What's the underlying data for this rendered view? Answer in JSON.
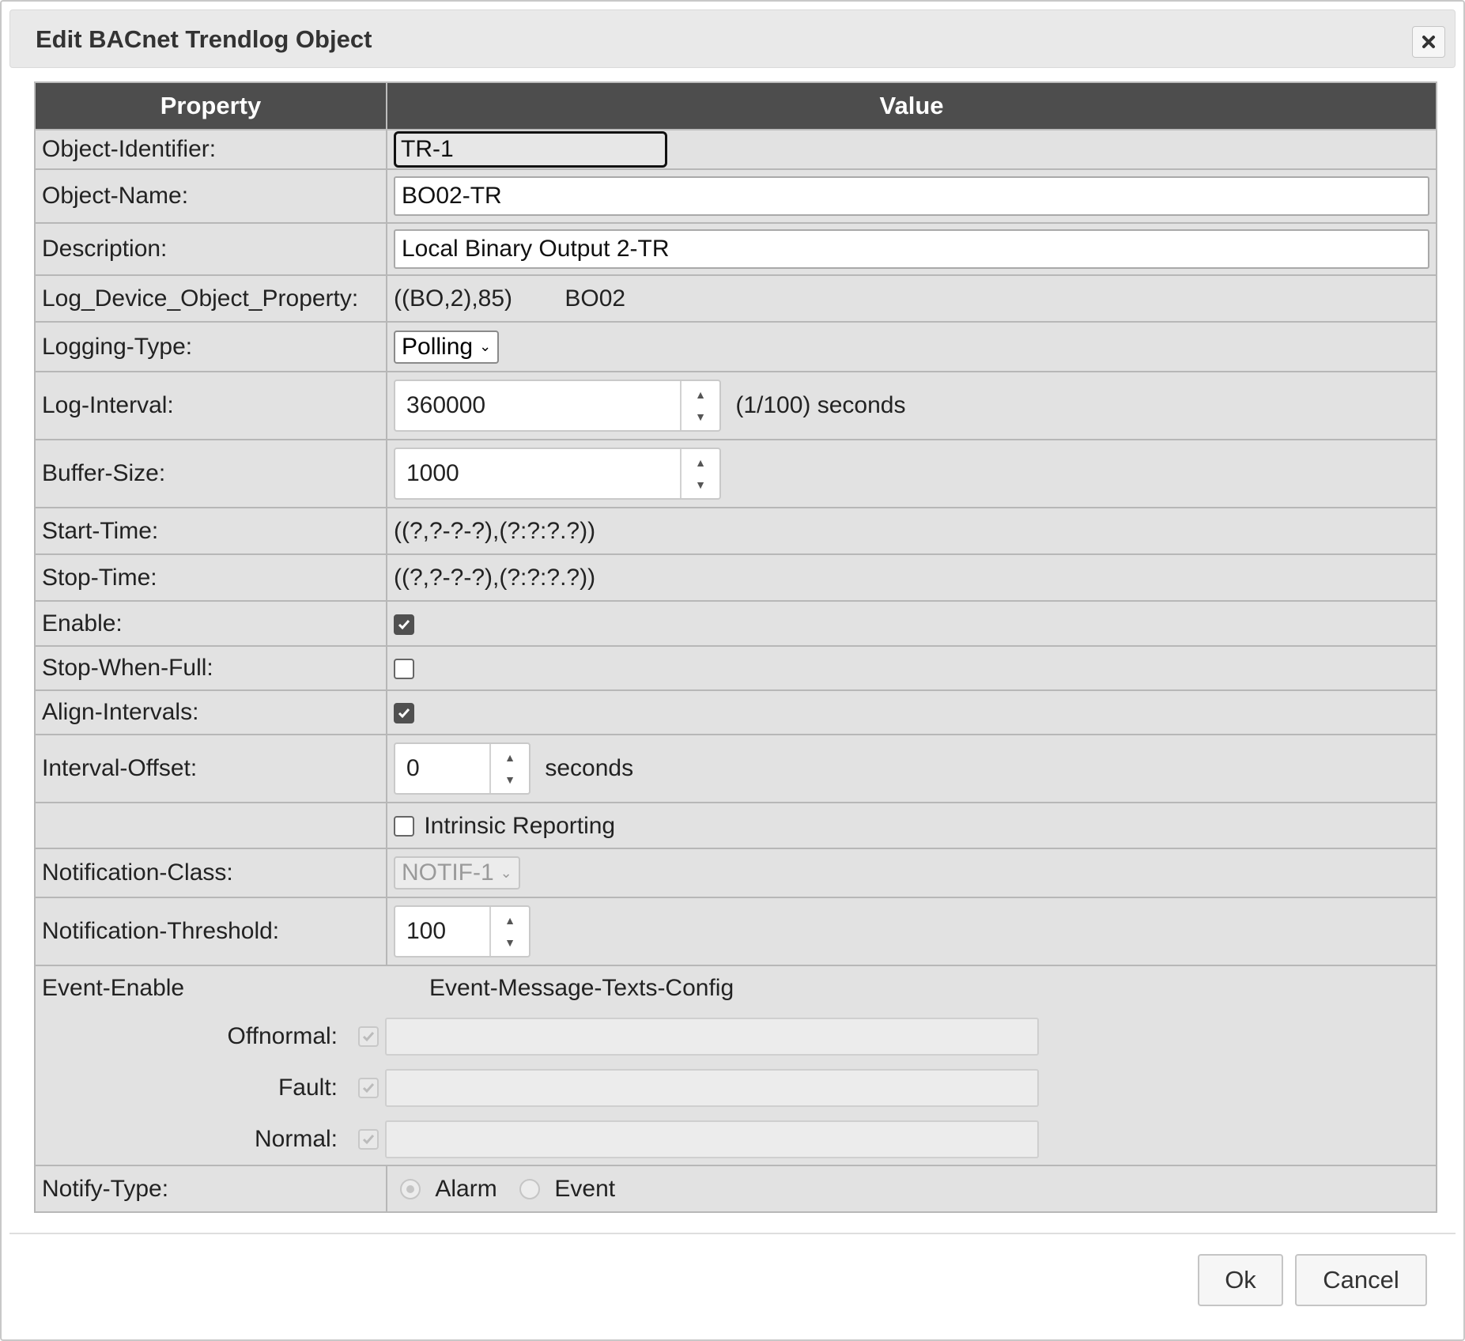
{
  "dialog": {
    "title": "Edit BACnet Trendlog Object",
    "close_icon": "close-icon"
  },
  "table": {
    "headers": {
      "property": "Property",
      "value": "Value"
    }
  },
  "rows": {
    "object_identifier": {
      "label": "Object-Identifier:",
      "value": "TR-1"
    },
    "object_name": {
      "label": "Object-Name:",
      "value": "BO02-TR"
    },
    "description": {
      "label": "Description:",
      "value": "Local Binary Output 2-TR"
    },
    "log_device_object_property": {
      "label": "Log_Device_Object_Property:",
      "value": "((BO,2),85)",
      "object": "BO02"
    },
    "logging_type": {
      "label": "Logging-Type:",
      "value": "Polling"
    },
    "log_interval": {
      "label": "Log-Interval:",
      "value": "360000",
      "unit": "(1/100) seconds"
    },
    "buffer_size": {
      "label": "Buffer-Size:",
      "value": "1000"
    },
    "start_time": {
      "label": "Start-Time:",
      "value": "((?,?-?-?),(?:?:?.?))"
    },
    "stop_time": {
      "label": "Stop-Time:",
      "value": "((?,?-?-?),(?:?:?.?))"
    },
    "enable": {
      "label": "Enable:",
      "checked": true
    },
    "stop_when_full": {
      "label": "Stop-When-Full:",
      "checked": false
    },
    "align_intervals": {
      "label": "Align-Intervals:",
      "checked": true
    },
    "interval_offset": {
      "label": "Interval-Offset:",
      "value": "0",
      "unit": "seconds"
    },
    "intrinsic_reporting": {
      "label": "Intrinsic Reporting",
      "checked": false
    },
    "notification_class": {
      "label": "Notification-Class:",
      "value": "NOTIF-1"
    },
    "notification_threshold": {
      "label": "Notification-Threshold:",
      "value": "100"
    },
    "event_enable": {
      "label": "Event-Enable",
      "config_label": "Event-Message-Texts-Config",
      "items": [
        {
          "label": "Offnormal:",
          "checked": true,
          "text": ""
        },
        {
          "label": "Fault:",
          "checked": true,
          "text": ""
        },
        {
          "label": "Normal:",
          "checked": true,
          "text": ""
        }
      ]
    },
    "notify_type": {
      "label": "Notify-Type:",
      "options": [
        "Alarm",
        "Event"
      ],
      "selected": "Alarm"
    }
  },
  "buttons": {
    "ok": "Ok",
    "cancel": "Cancel"
  }
}
